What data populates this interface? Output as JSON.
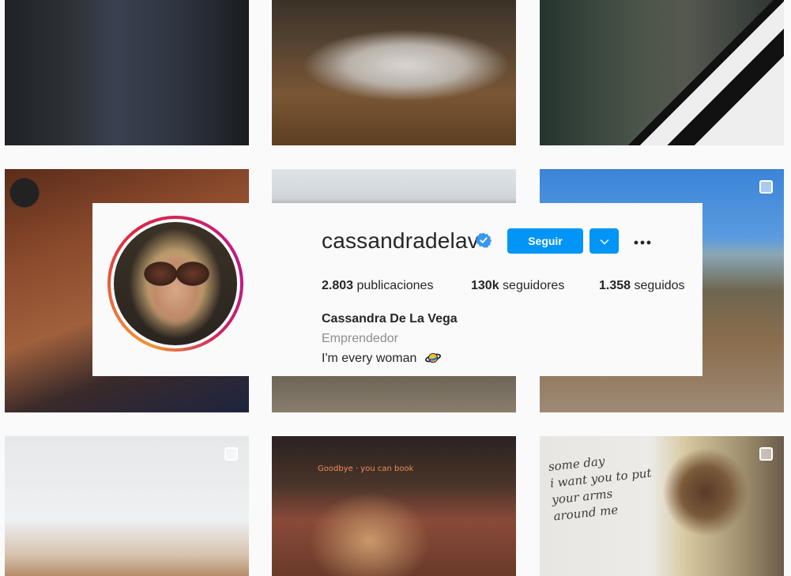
{
  "profile": {
    "username": "cassandradelav",
    "verified_icon": "verified-badge-icon",
    "follow_label": "Seguir",
    "suggest_icon": "chevron-down-icon",
    "more_icon": "more-options-icon",
    "stats": {
      "posts_count": "2.803",
      "posts_label": "publicaciones",
      "followers_count": "130k",
      "followers_label": "seguidores",
      "following_count": "1.358",
      "following_label": "seguidos"
    },
    "full_name": "Cassandra De La Vega",
    "category": "Emprendedor",
    "bio": "I'm every woman",
    "bio_emoji_icon": "planet-emoji-icon"
  },
  "grid": {
    "mural_text": [
      "some day",
      "i want you to put",
      "your arms",
      "around me"
    ],
    "neon_text": "Goodbye · you can book"
  },
  "colors": {
    "accent_blue": "#0095f6",
    "text_primary": "#262626",
    "text_secondary": "#8e8e8e",
    "background": "#fafafa"
  }
}
